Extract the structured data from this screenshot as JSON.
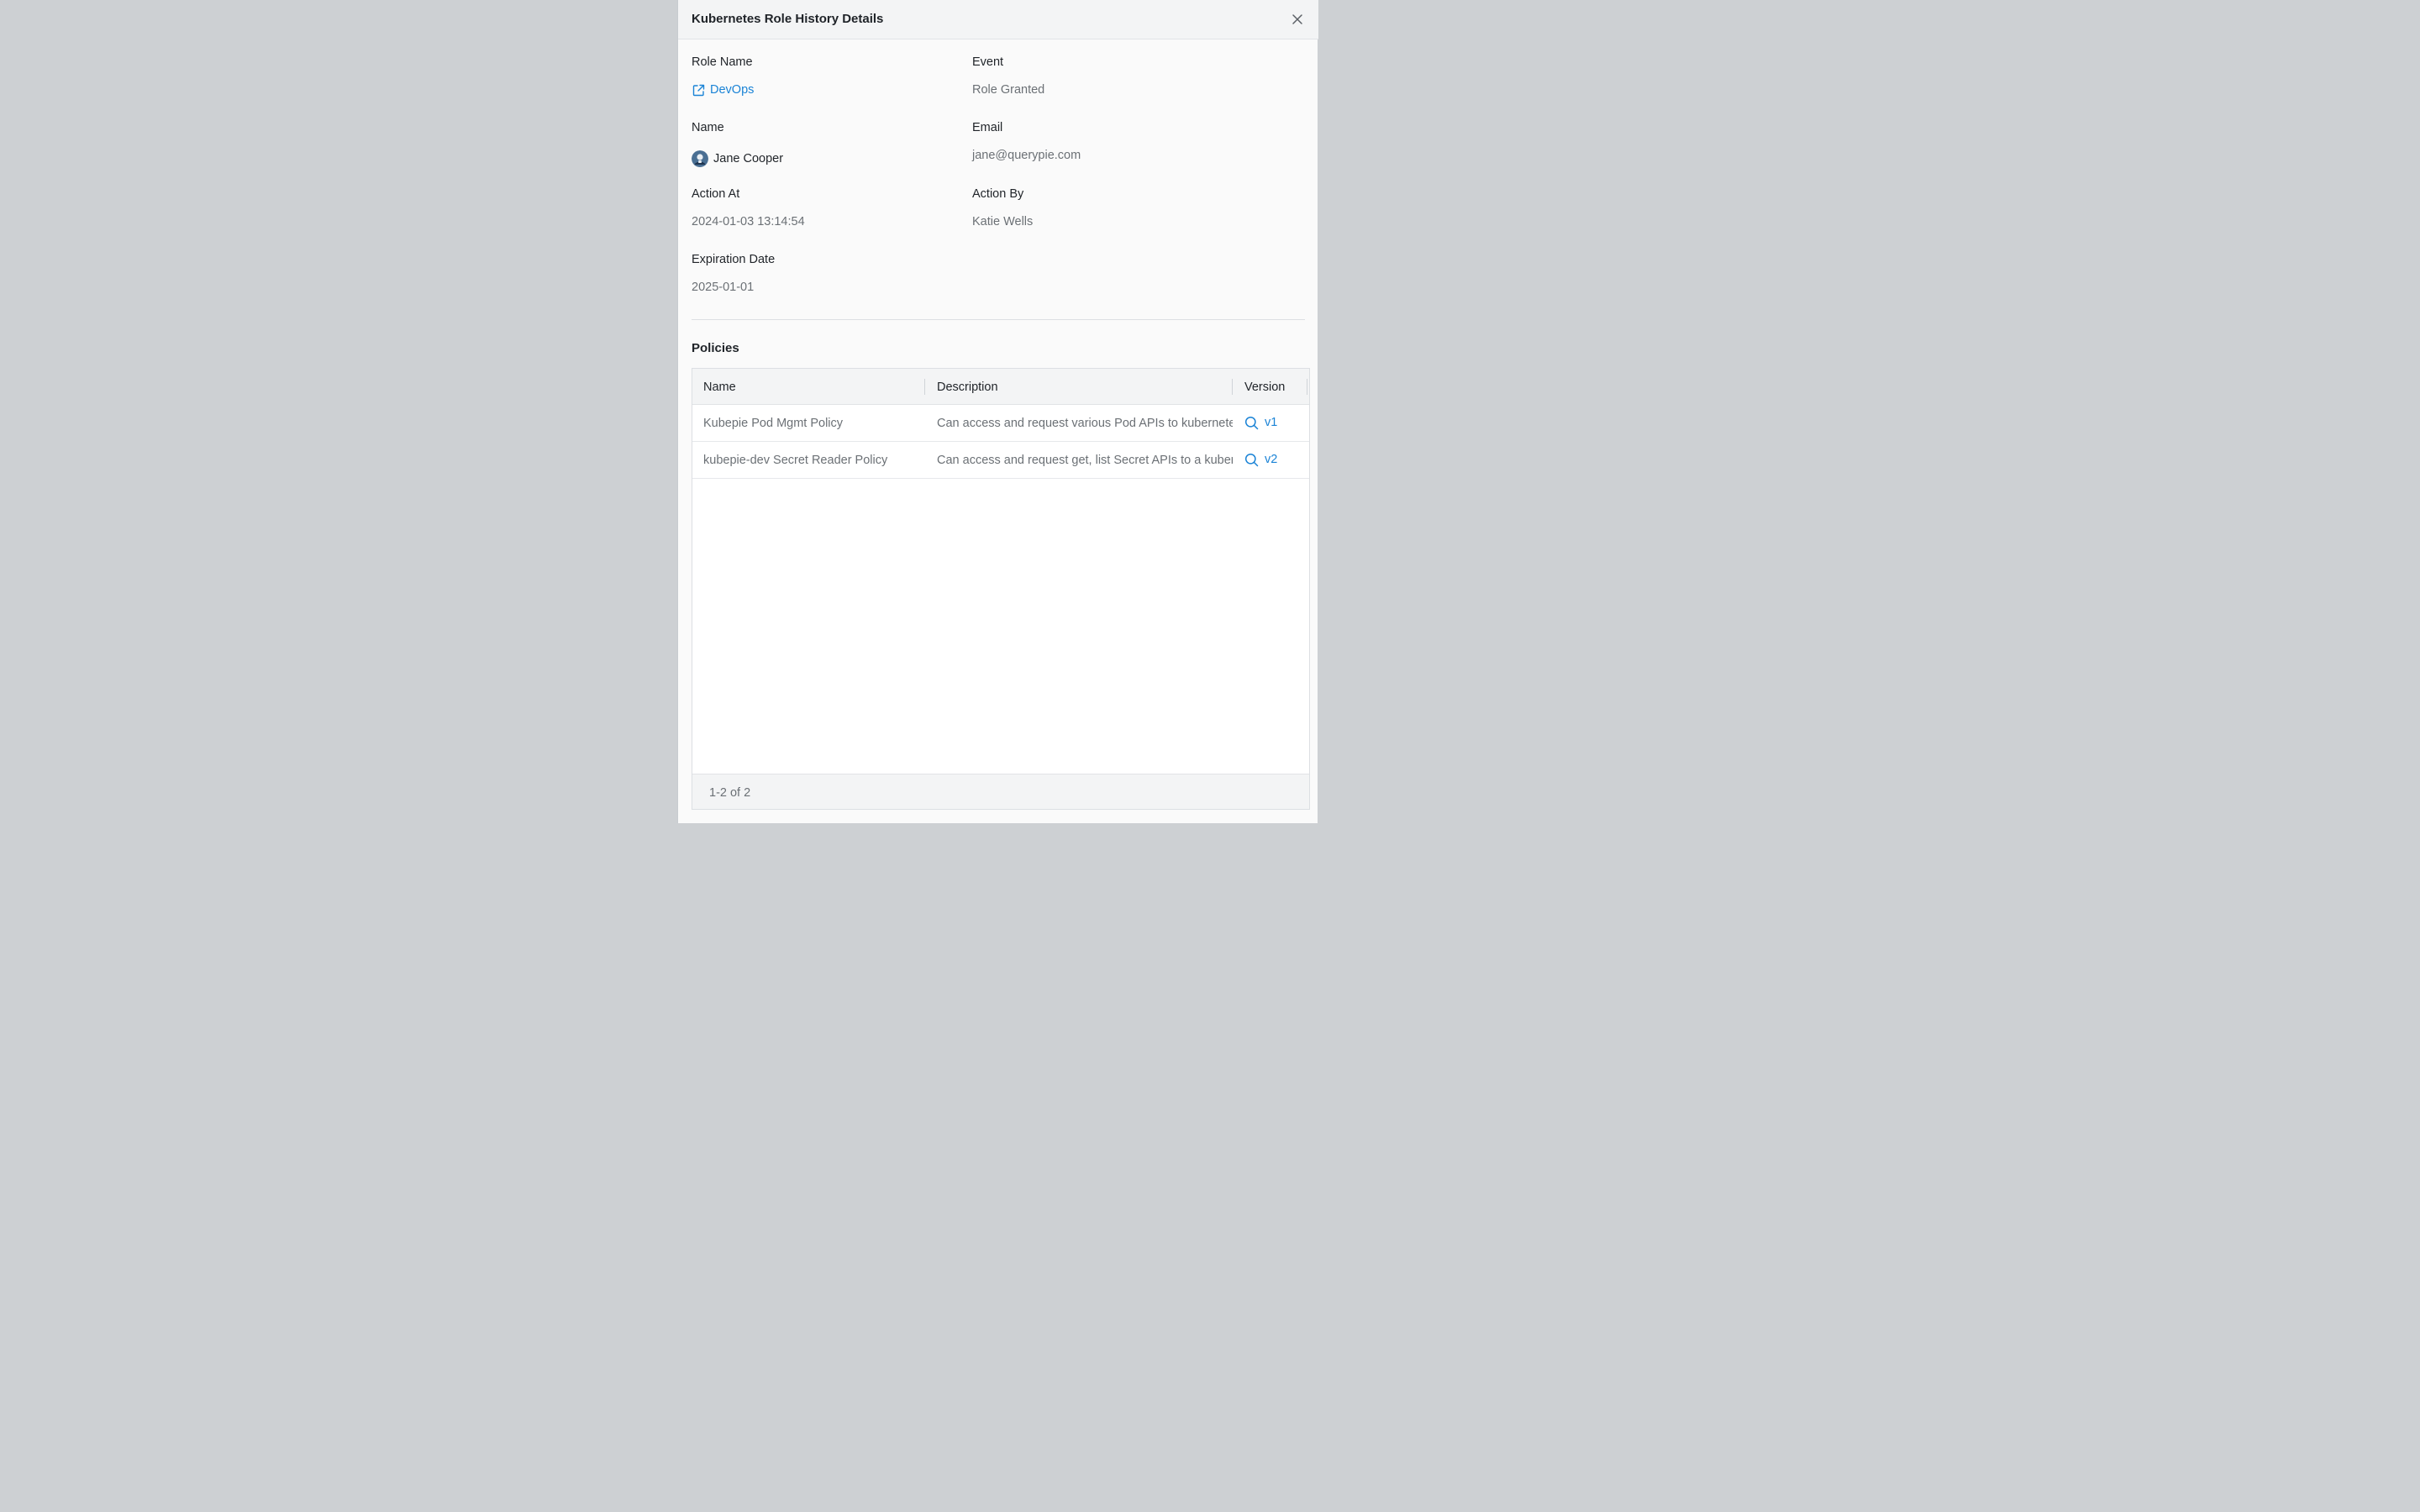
{
  "drawer": {
    "title": "Kubernetes Role History Details",
    "close_icon": "close-icon"
  },
  "details": {
    "role_name": {
      "label": "Role Name",
      "value": "DevOps",
      "icon": "external-link-icon"
    },
    "event": {
      "label": "Event",
      "value": "Role Granted"
    },
    "name": {
      "label": "Name",
      "value": "Jane Cooper",
      "icon": "avatar"
    },
    "email": {
      "label": "Email",
      "value": "jane@querypie.com"
    },
    "action_at": {
      "label": "Action At",
      "value": "2024-01-03 13:14:54"
    },
    "action_by": {
      "label": "Action By",
      "value": "Katie Wells"
    },
    "expiration_date": {
      "label": "Expiration Date",
      "value": "2025-01-01"
    }
  },
  "policies": {
    "title": "Policies",
    "columns": [
      "Name",
      "Description",
      "Version"
    ],
    "rows": [
      {
        "name": "Kubepie Pod Mgmt Policy",
        "description": "Can access and request various Pod APIs to kubernetes",
        "version": "v1"
      },
      {
        "name": "kubepie-dev Secret Reader Policy",
        "description": "Can access and request get, list Secret APIs to a kubernetes",
        "version": "v2"
      }
    ],
    "footer": "1-2 of 2"
  },
  "colors": {
    "accent": "#1a83d6",
    "backdrop": "#cdd0d3",
    "panel": "#fafafa"
  }
}
